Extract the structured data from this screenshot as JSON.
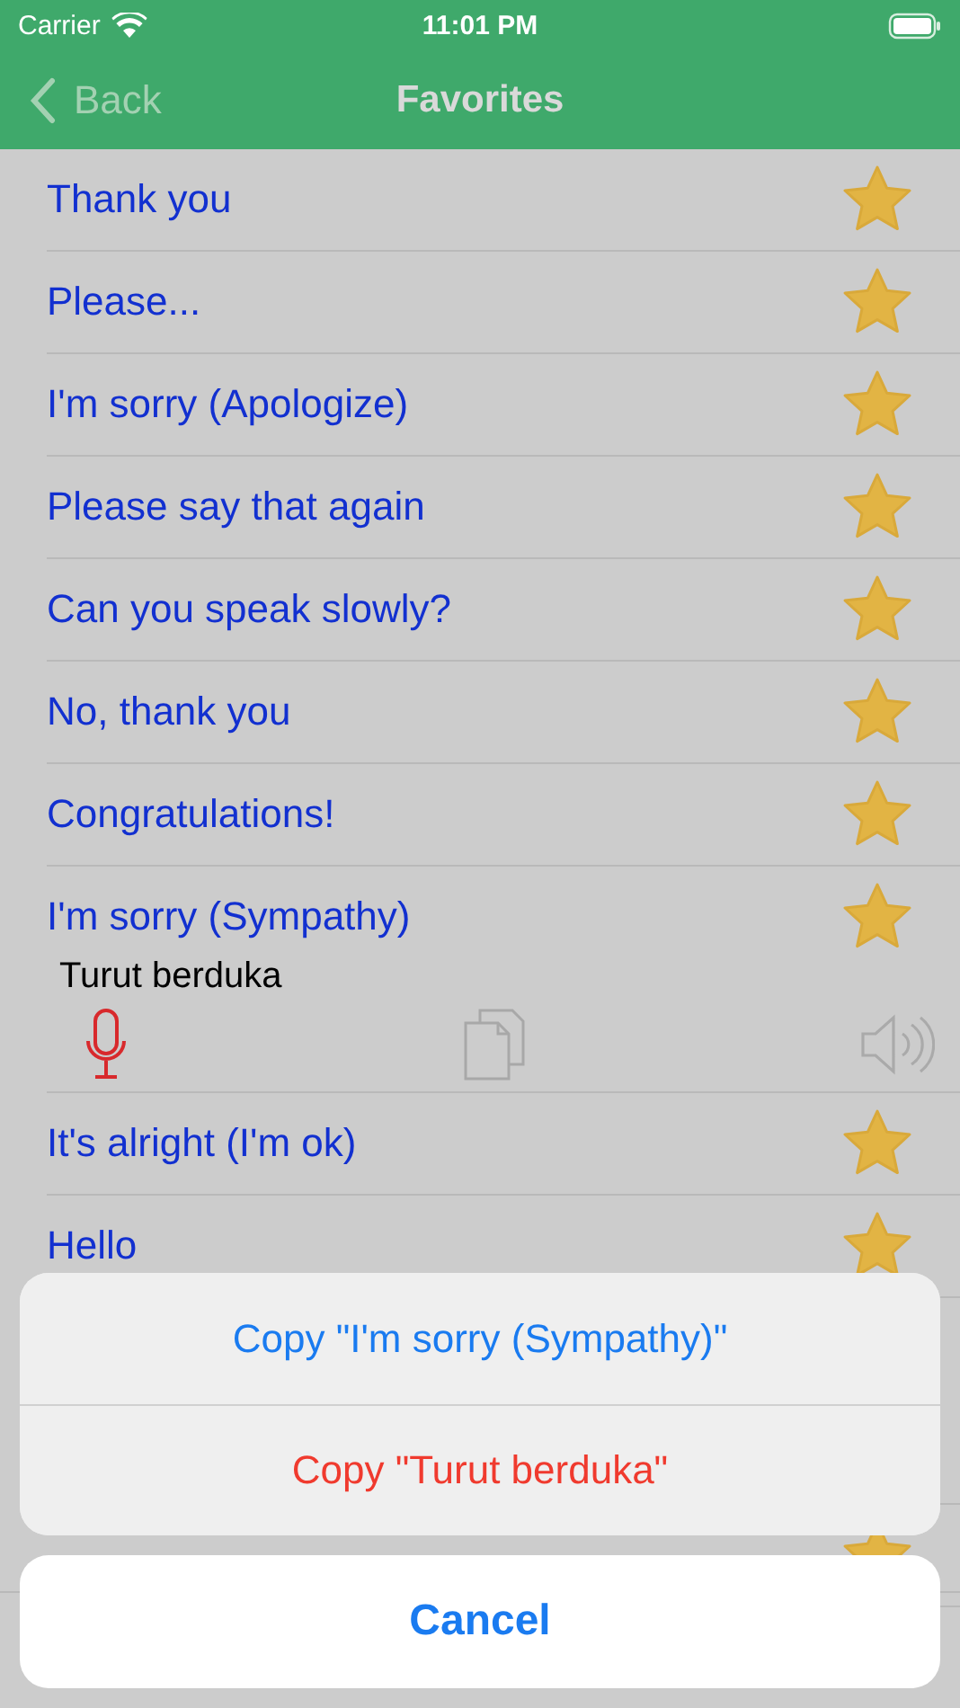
{
  "status_bar": {
    "carrier": "Carrier",
    "time": "11:01 PM"
  },
  "nav": {
    "back": "Back",
    "title": "Favorites"
  },
  "rows": [
    {
      "text": "Thank you",
      "favorite": true
    },
    {
      "text": "Please...",
      "favorite": true
    },
    {
      "text": "I'm sorry (Apologize)",
      "favorite": true
    },
    {
      "text": "Please say that again",
      "favorite": true
    },
    {
      "text": "Can you speak slowly?",
      "favorite": true
    },
    {
      "text": "No, thank you",
      "favorite": true
    },
    {
      "text": "Congratulations!",
      "favorite": true
    },
    {
      "text": "I'm sorry (Sympathy)",
      "favorite": true,
      "expanded": true,
      "translation": "Turut berduka"
    },
    {
      "text": "It's alright (I'm ok)",
      "favorite": true
    },
    {
      "text": "Hello",
      "favorite": true
    }
  ],
  "lower_rows": [
    {
      "favorite": true
    }
  ],
  "action_sheet": {
    "actions": [
      {
        "label": "Copy \"I'm sorry (Sympathy)\"",
        "kind": "default"
      },
      {
        "label": "Copy \"Turut berduka\"",
        "kind": "destructive"
      }
    ],
    "cancel": "Cancel"
  }
}
